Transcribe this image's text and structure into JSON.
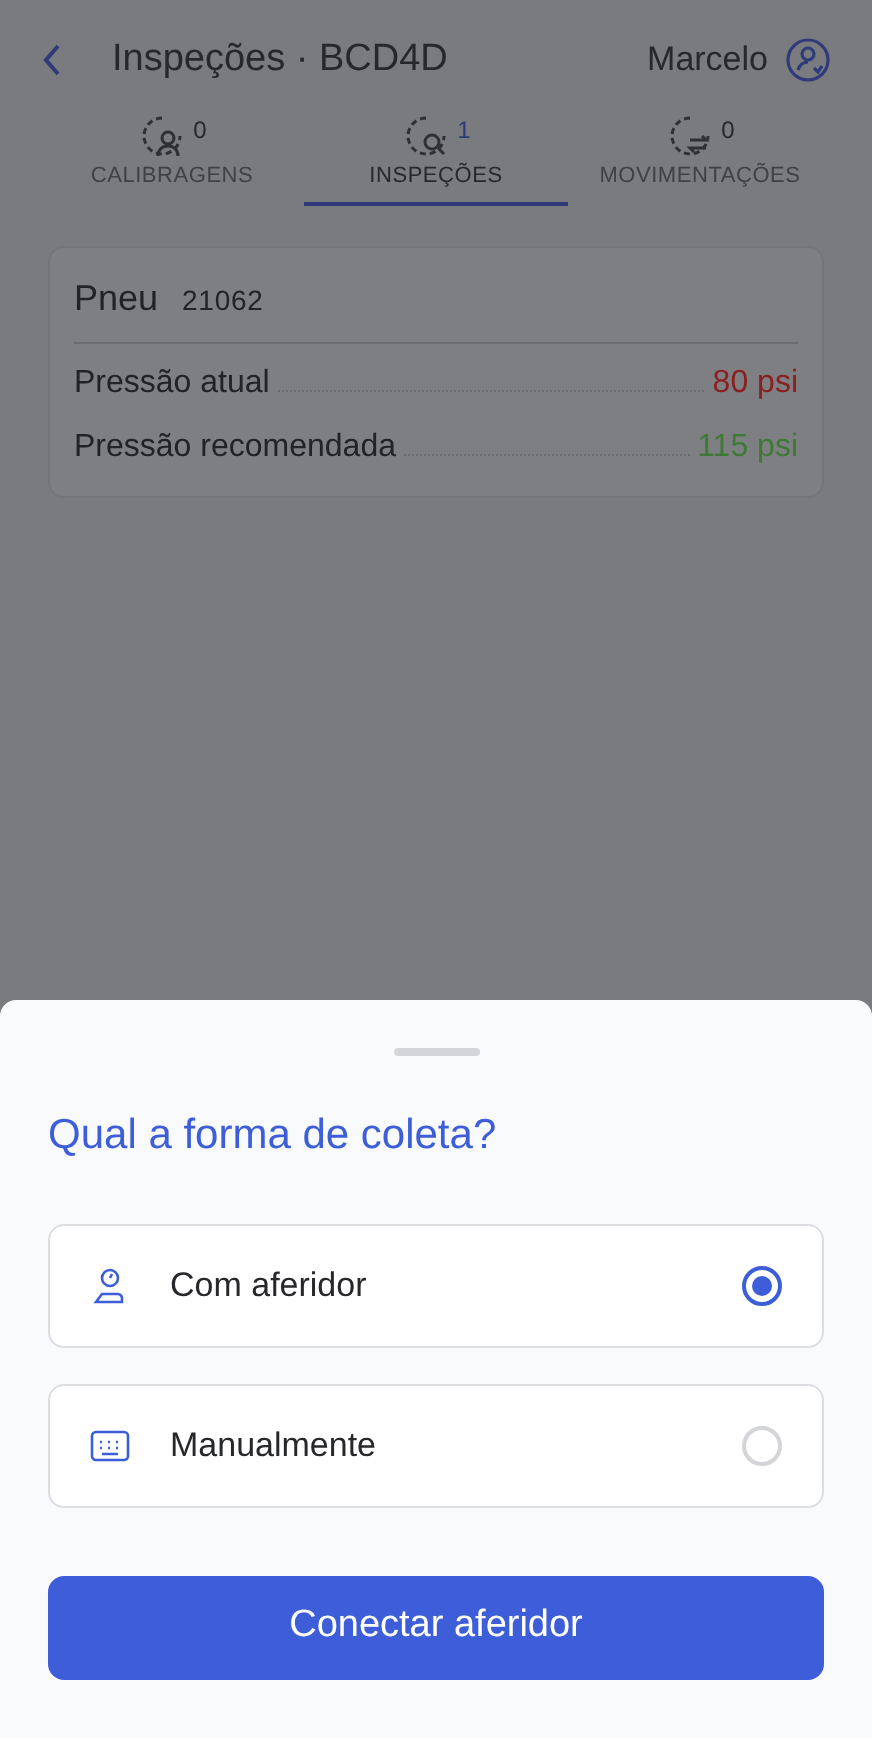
{
  "header": {
    "title": "Inspeções · BCD4D",
    "user": "Marcelo"
  },
  "tabs": [
    {
      "kind": "calibration",
      "label": "CALIBRAGENS",
      "count": "0",
      "selected": false
    },
    {
      "kind": "inspection",
      "label": "INSPEÇÕES",
      "count": "1",
      "selected": true
    },
    {
      "kind": "movement",
      "label": "MOVIMENTAÇÕES",
      "count": "0",
      "selected": false
    }
  ],
  "card": {
    "title": "Pneu",
    "number": "21062",
    "rows": [
      {
        "label": "Pressão atual",
        "value": "80 psi",
        "color": "#8a2020"
      },
      {
        "label": "Pressão recomendada",
        "value": "115 psi",
        "color": "#3e7a36"
      }
    ]
  },
  "sheet": {
    "title": "Qual a forma de coleta?",
    "options": [
      {
        "kind": "gauge",
        "label": "Com aferidor",
        "selected": true
      },
      {
        "kind": "keyboard",
        "label": "Manualmente",
        "selected": false
      }
    ],
    "button": "Conectar aferidor"
  }
}
